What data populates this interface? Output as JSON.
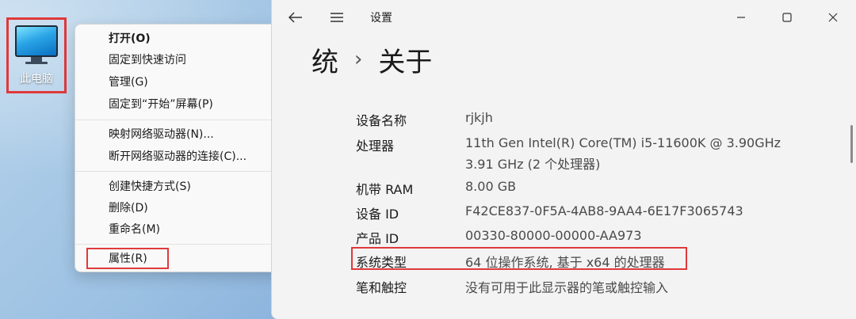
{
  "desktop": {
    "icon": {
      "label": "此电脑",
      "icon": "this-pc-icon"
    }
  },
  "context_menu": {
    "items": [
      {
        "label": "打开(O)",
        "bold": true
      },
      {
        "label": "固定到快速访问"
      },
      {
        "label": "管理(G)"
      },
      {
        "label": "固定到“开始”屏幕(P)"
      },
      {
        "label": "映射网络驱动器(N)..."
      },
      {
        "label": "断开网络驱动器的连接(C)..."
      },
      {
        "label": "创建快捷方式(S)"
      },
      {
        "label": "删除(D)"
      },
      {
        "label": "重命名(M)"
      },
      {
        "label": "属性(R)",
        "highlighted": true
      }
    ]
  },
  "settings": {
    "window_title": "设置",
    "breadcrumb": {
      "parent": "统",
      "current": "关于"
    },
    "specs": [
      {
        "label": "设备名称",
        "value": "rjkjh"
      },
      {
        "label": "处理器",
        "value": "11th Gen Intel(R) Core(TM) i5-11600K @ 3.90GHz",
        "value2": "3.91 GHz  (2 个处理器)"
      },
      {
        "label": "机带 RAM",
        "value": "8.00 GB"
      },
      {
        "label": "设备 ID",
        "value": "F42CE837-0F5A-4AB8-9AA4-6E17F3065743"
      },
      {
        "label": "产品 ID",
        "value": "00330-80000-00000-AA973"
      },
      {
        "label": "系统类型",
        "value": "64 位操作系统, 基于 x64 的处理器",
        "highlighted": true
      },
      {
        "label": "笔和触控",
        "value": "没有可用于此显示器的笔或触控输入"
      }
    ]
  },
  "colors": {
    "highlight_border": "#e0393a"
  }
}
